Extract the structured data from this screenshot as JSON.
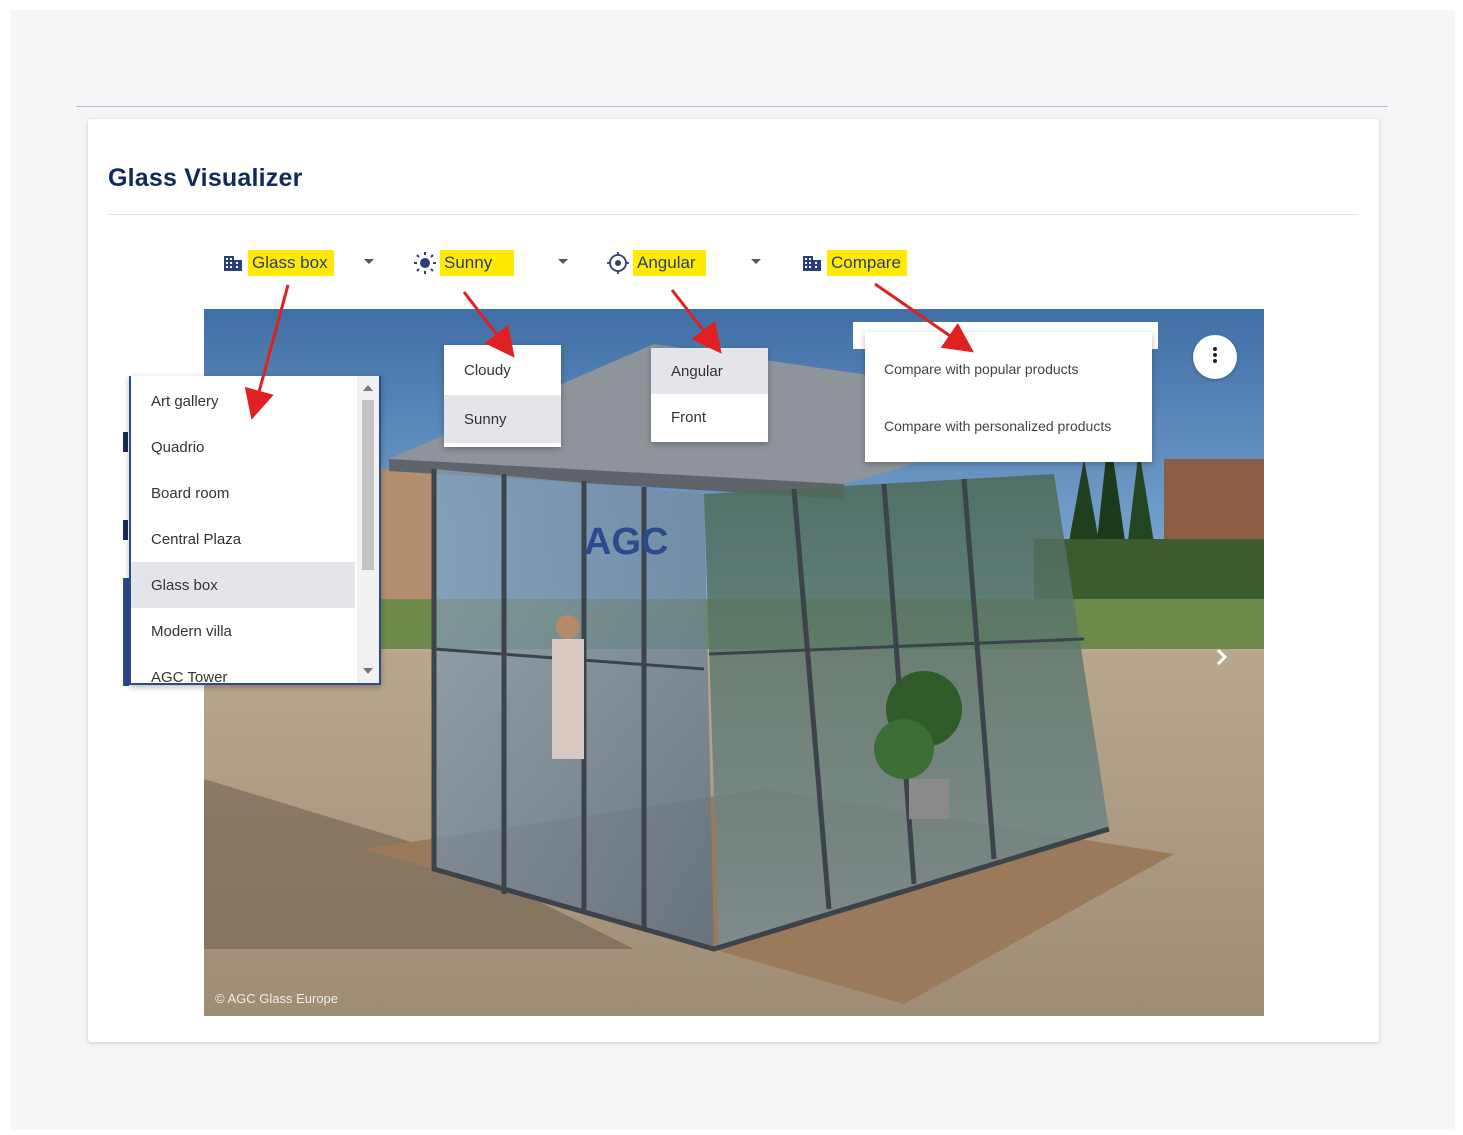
{
  "page": {
    "title": "Glass Visualizer"
  },
  "toolbar": {
    "scene": {
      "label": "Glass box",
      "icon": "building-icon"
    },
    "weather": {
      "label": "Sunny",
      "icon": "sun-icon"
    },
    "view": {
      "label": "Angular",
      "icon": "target-icon"
    },
    "compare": {
      "label": "Compare",
      "icon": "building-icon"
    }
  },
  "scene_menu": {
    "items": [
      "Art gallery",
      "Quadrio",
      "Board room",
      "Central Plaza",
      "Glass box",
      "Modern villa",
      "AGC Tower"
    ],
    "selected": "Glass box"
  },
  "weather_menu": {
    "items": [
      "Cloudy",
      "Sunny"
    ],
    "selected": "Sunny"
  },
  "view_menu": {
    "items": [
      "Angular",
      "Front"
    ],
    "selected": "Angular"
  },
  "compare_menu": {
    "items": [
      "Compare with popular products",
      "Compare with personalized products"
    ]
  },
  "image": {
    "copyright": "© AGC Glass Europe",
    "sign_text": "AGC"
  },
  "colors": {
    "highlight": "#ffea00",
    "title": "#0f2a5c",
    "arrow": "#e02020",
    "accent": "#2b4b8c"
  }
}
